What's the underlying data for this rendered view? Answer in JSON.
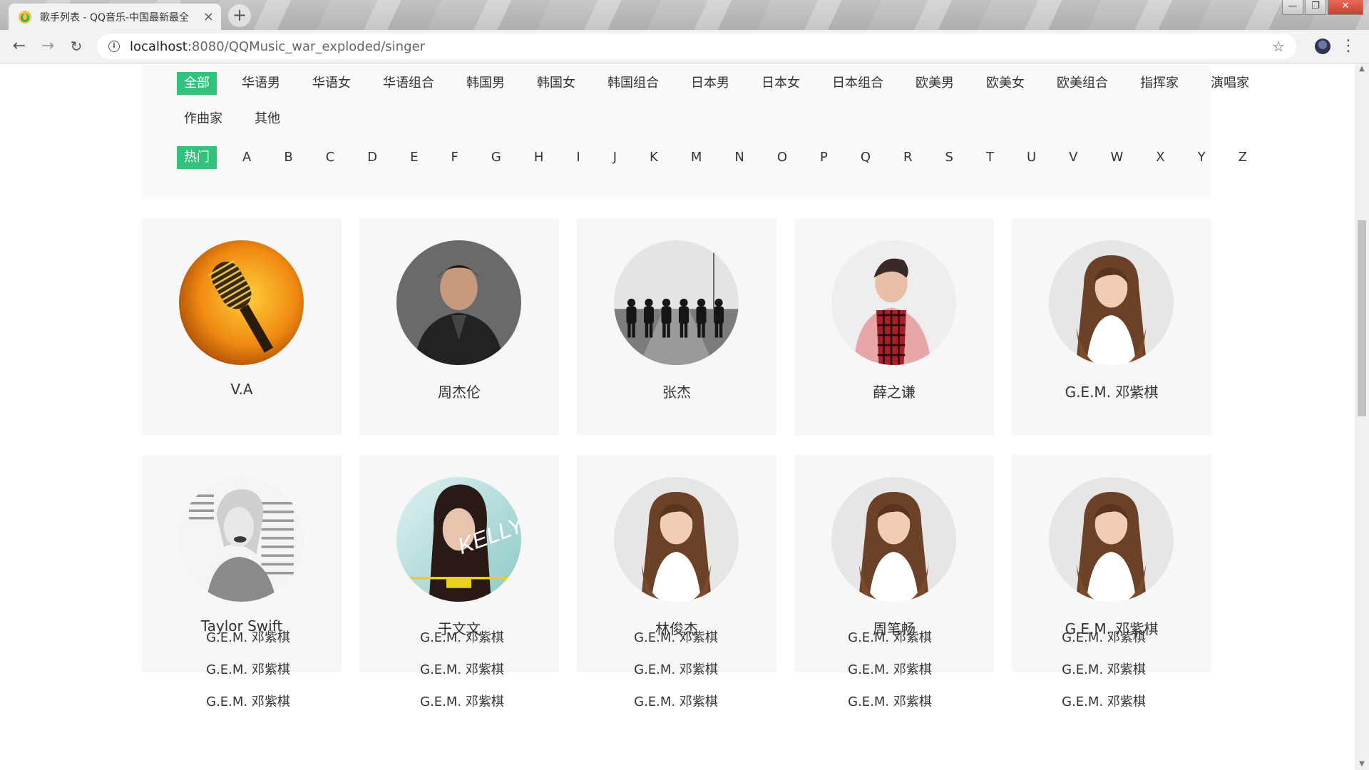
{
  "browser": {
    "tab_title": "歌手列表 - QQ音乐-中国最新最全",
    "tab_close": "×",
    "new_tab": "+",
    "url_host": "localhost",
    "url_path": ":8080/QQMusic_war_exploded/singer",
    "info_icon": "i",
    "back": "←",
    "forward": "→",
    "reload": "↻",
    "star": "☆",
    "menu": "⋮",
    "window": {
      "minimize": "—",
      "restore": "❐",
      "close": "✕"
    }
  },
  "filters": {
    "categories": [
      "全部",
      "华语男",
      "华语女",
      "华语组合",
      "韩国男",
      "韩国女",
      "韩国组合",
      "日本男",
      "日本女",
      "日本组合",
      "欧美男",
      "欧美女",
      "欧美组合",
      "指挥家",
      "演唱家"
    ],
    "categories_row2": [
      "作曲家",
      "其他"
    ],
    "active_category": "全部",
    "letters": [
      "热门",
      "A",
      "B",
      "C",
      "D",
      "E",
      "F",
      "G",
      "H",
      "I",
      "J",
      "K",
      "M",
      "N",
      "O",
      "P",
      "Q",
      "R",
      "S",
      "T",
      "U",
      "V",
      "W",
      "X",
      "Y",
      "Z"
    ],
    "active_letter": "热门"
  },
  "singers": [
    {
      "name": "V.A",
      "image": "microphone-photo"
    },
    {
      "name": "周杰伦",
      "image": "portrait-dark-suit"
    },
    {
      "name": "张杰",
      "image": "group-on-road-bw"
    },
    {
      "name": "薛之谦",
      "image": "portrait-pink-coat"
    },
    {
      "name": "G.E.M. 邓紫棋",
      "image": "portrait-long-hair"
    },
    {
      "name": "Taylor Swift",
      "image": "portrait-bw-newspaper"
    },
    {
      "name": "于文文",
      "image": "album-kelly"
    },
    {
      "name": "林俊杰",
      "image": "portrait-long-hair"
    },
    {
      "name": "周笔畅",
      "image": "portrait-long-hair"
    },
    {
      "name": "G.E.M. 邓紫棋",
      "image": "portrait-long-hair"
    }
  ],
  "text_list": [
    [
      "G.E.M. 邓紫棋",
      "G.E.M. 邓紫棋",
      "G.E.M. 邓紫棋",
      "G.E.M. 邓紫棋",
      "G.E.M. 邓紫棋"
    ],
    [
      "G.E.M. 邓紫棋",
      "G.E.M. 邓紫棋",
      "G.E.M. 邓紫棋",
      "G.E.M. 邓紫棋",
      "G.E.M. 邓紫棋"
    ],
    [
      "G.E.M. 邓紫棋",
      "G.E.M. 邓紫棋",
      "G.E.M. 邓紫棋",
      "G.E.M. 邓紫棋",
      "G.E.M. 邓紫棋"
    ]
  ],
  "colors": {
    "accent": "#31c27c",
    "panel": "#fafafa",
    "card": "#f7f7f7"
  }
}
